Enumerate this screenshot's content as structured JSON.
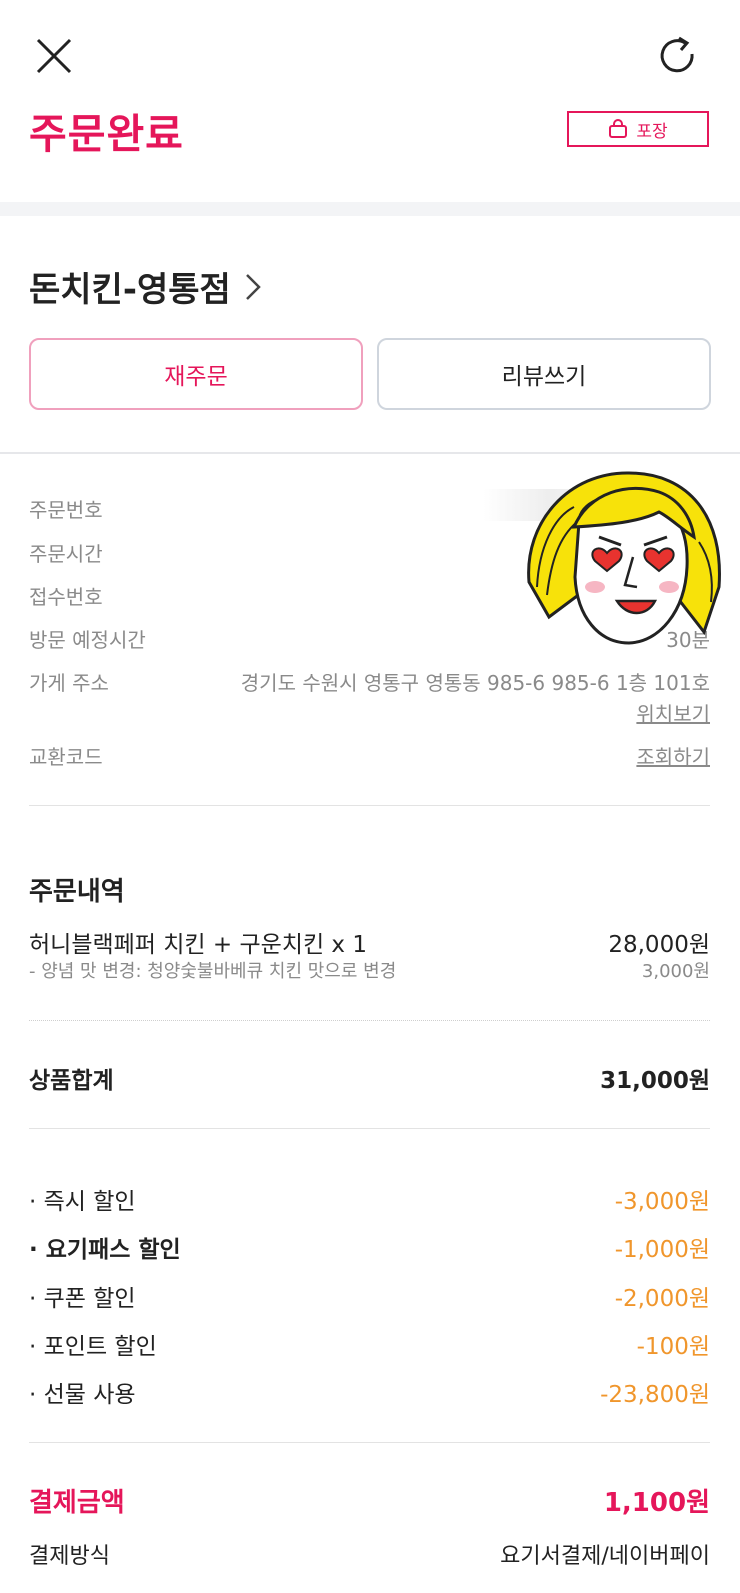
{
  "header": {
    "close_icon": "close-icon",
    "refresh_icon": "refresh-icon",
    "title": "주문완료",
    "order_type_badge": "포장",
    "badge_icon": "shopping-bag-icon"
  },
  "store": {
    "name": "돈치킨-영통점",
    "chevron_icon": "chevron-right-icon"
  },
  "actions": {
    "reorder": "재주문",
    "review": "리뷰쓰기"
  },
  "order_info": {
    "order_number_label": "주문번호",
    "order_time_label": "주문시간",
    "receipt_number_label": "접수번호",
    "visit_time_label": "방문 예정시간",
    "visit_time_value_visible": "30분",
    "store_address_label": "가게 주소",
    "store_address_value": "경기도 수원시 영통구 영통동 985-6 985-6 1층 101호",
    "location_link": "위치보기",
    "exchange_code_label": "교환코드",
    "exchange_code_link": "조회하기"
  },
  "order_details": {
    "title": "주문내역",
    "items": [
      {
        "name": "허니블랙페퍼 치킨 + 구운치킨 x 1",
        "price": "28,000원",
        "option": "- 양념 맛 변경: 청양숯불바베큐 치킨 맛으로 변경",
        "option_price": "3,000원"
      }
    ]
  },
  "subtotal": {
    "label": "상품합계",
    "value": "31,000원"
  },
  "discounts": [
    {
      "label": "· 즉시 할인",
      "value": "-3,000원",
      "bold": false
    },
    {
      "label": "· 요기패스 할인",
      "value": "-1,000원",
      "bold": true
    },
    {
      "label": "· 쿠폰 할인",
      "value": "-2,000원",
      "bold": false
    },
    {
      "label": "· 포인트 할인",
      "value": "-100원",
      "bold": false
    },
    {
      "label": "· 선물 사용",
      "value": "-23,800원",
      "bold": false
    }
  ],
  "payment": {
    "amount_label": "결제금액",
    "amount_value": "1,100원",
    "method_label": "결제방식",
    "method_value": "요기서결제/네이버페이"
  },
  "colors": {
    "accent": "#e5165a",
    "discount": "#f0962c",
    "muted": "#8a8a8a"
  },
  "sticker": {
    "icon": "heart-eyes-girl-sticker"
  }
}
